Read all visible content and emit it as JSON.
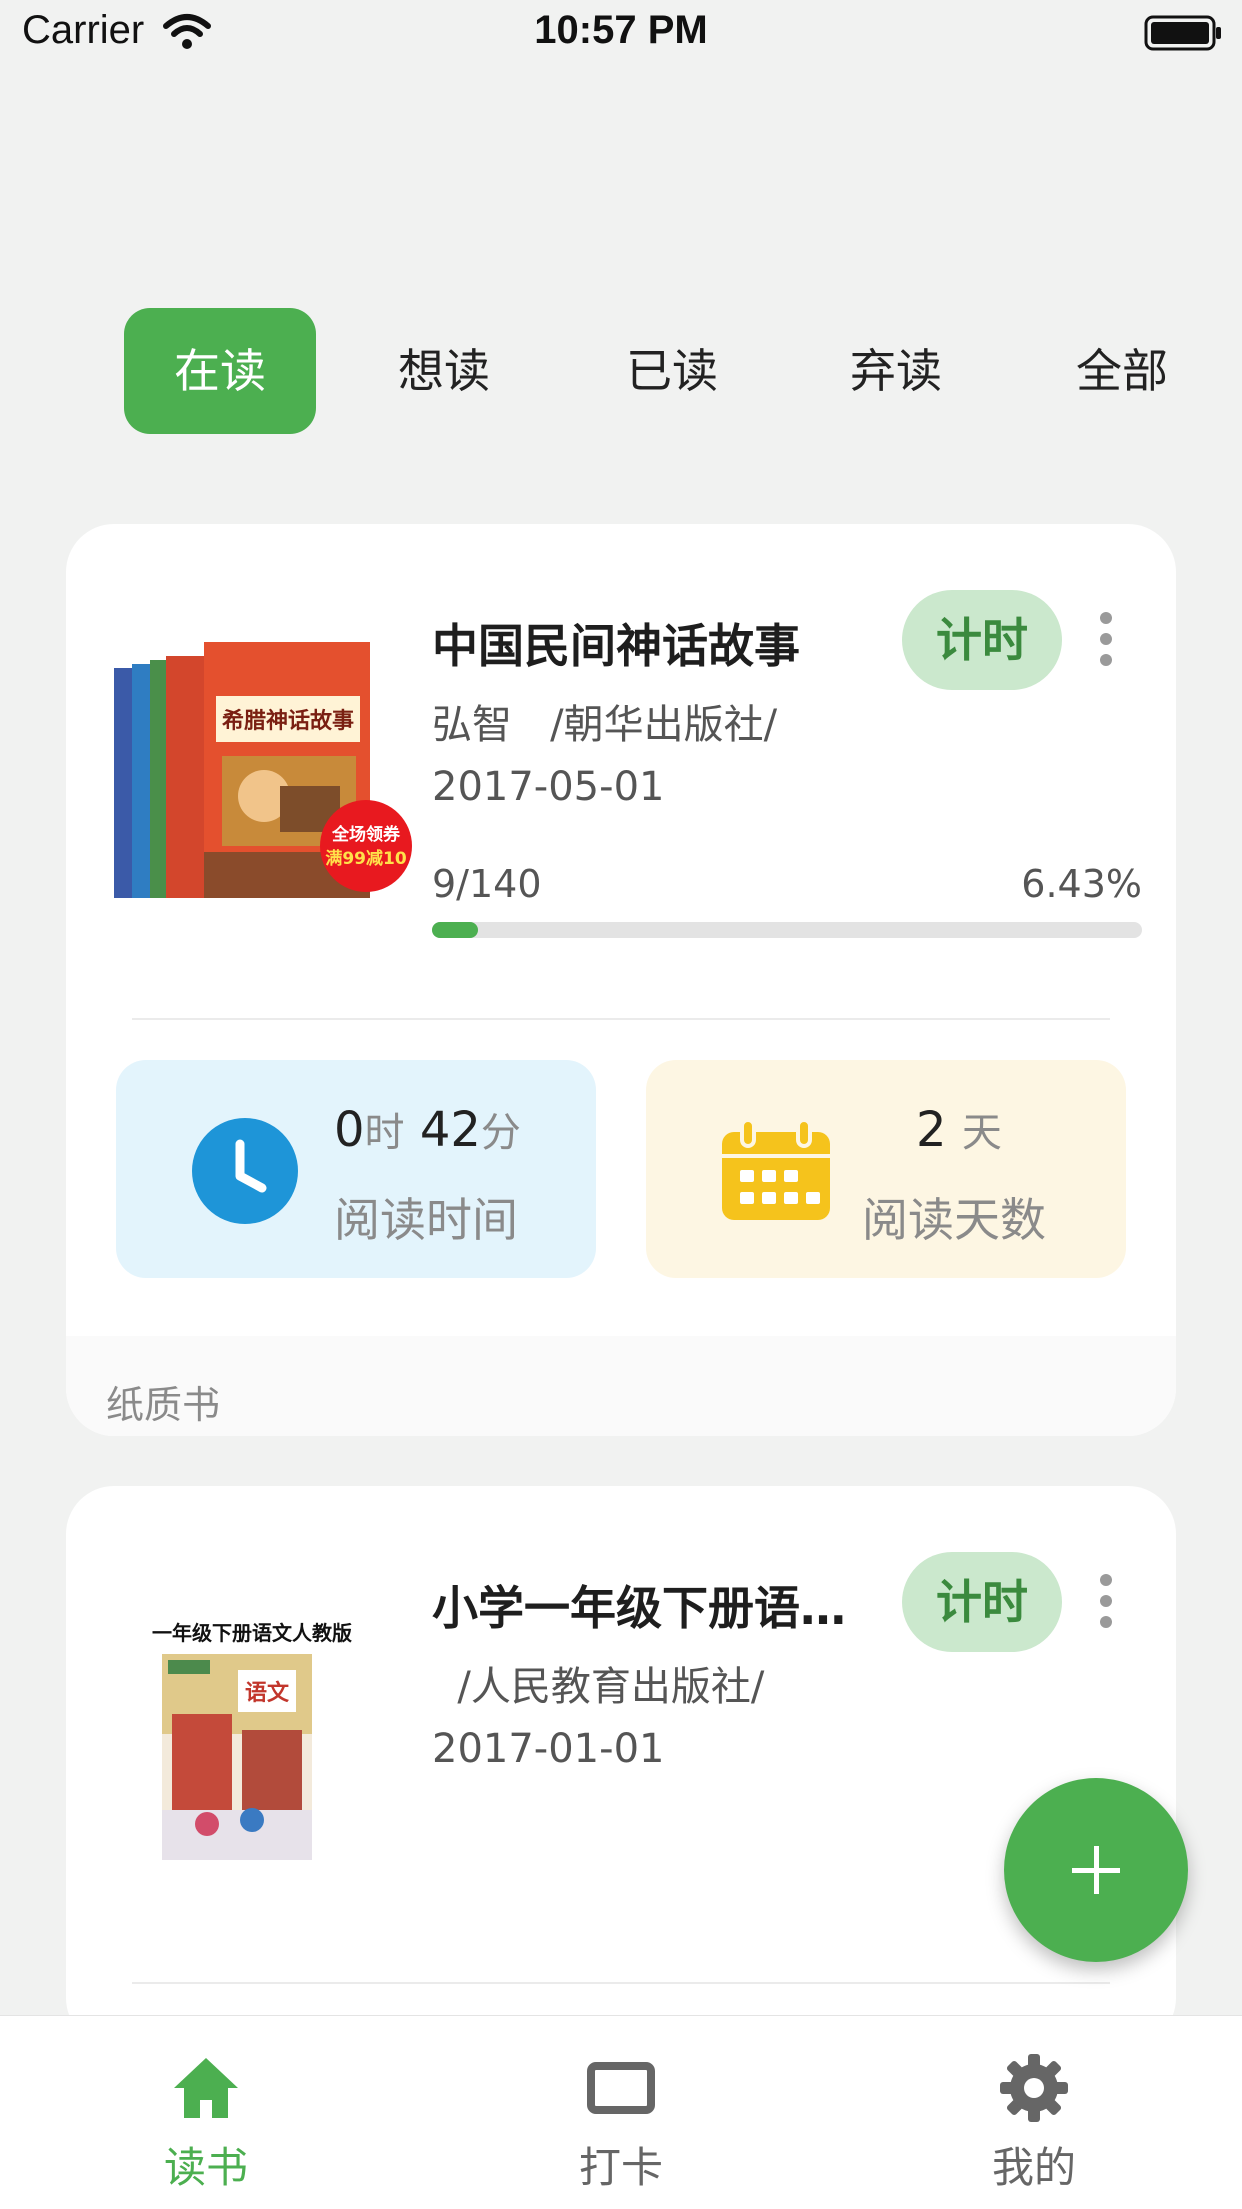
{
  "status_bar": {
    "carrier": "Carrier",
    "time": "10:57 PM"
  },
  "tabs": [
    {
      "label": "在读",
      "active": true
    },
    {
      "label": "想读",
      "active": false
    },
    {
      "label": "已读",
      "active": false
    },
    {
      "label": "弃读",
      "active": false
    },
    {
      "label": "全部",
      "active": false
    }
  ],
  "books": [
    {
      "title": "中国民间神话故事",
      "publisher_line": "弘智   /朝华出版社/",
      "date": "2017-05-01",
      "timer_label": "计时",
      "progress_pages": "9/140",
      "progress_percent": "6.43%",
      "progress_fraction": 0.0643,
      "reading_time_hours": "0",
      "reading_time_hours_unit": "时",
      "reading_time_minutes": "42",
      "reading_time_minutes_unit": "分",
      "reading_time_label": "阅读时间",
      "reading_days": "2",
      "reading_days_unit": "天",
      "reading_days_label": "阅读天数",
      "book_type": "纸质书",
      "cover_badge_line1": "全场领券",
      "cover_badge_line2": "满99减10",
      "cover_title": "希腊神话故事"
    },
    {
      "title": "小学一年级下册语…",
      "publisher_line": "  /人民教育出版社/",
      "date": "2017-01-01",
      "timer_label": "计时",
      "cover_header": "一年级下册语文人教版",
      "cover_title": "语文"
    }
  ],
  "fab": {
    "icon": "plus-icon"
  },
  "bottom_nav": [
    {
      "label": "读书",
      "icon": "home-icon",
      "active": true
    },
    {
      "label": "打卡",
      "icon": "checkin-icon",
      "active": false
    },
    {
      "label": "我的",
      "icon": "gear-icon",
      "active": false
    }
  ],
  "colors": {
    "accent": "#4caf50",
    "timer_bg": "#cbe8cd",
    "time_box_bg": "#e3f4fc",
    "days_box_bg": "#fdf6e3",
    "clock_blue": "#1e95d8",
    "calendar_yellow": "#f5c31c"
  }
}
